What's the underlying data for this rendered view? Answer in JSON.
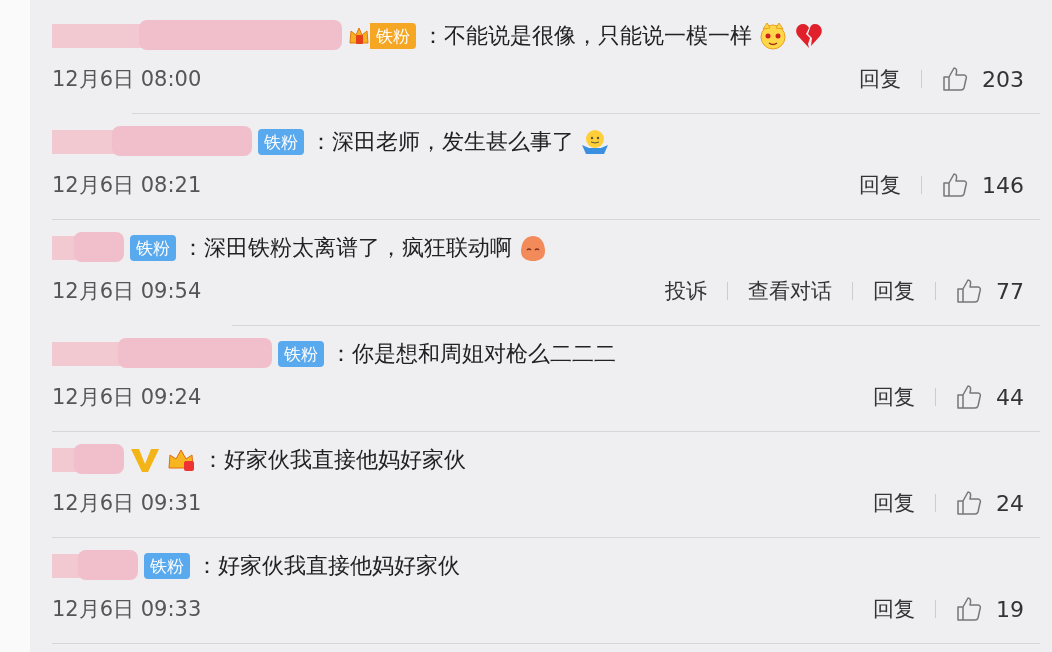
{
  "comments": [
    {
      "badges": [
        {
          "kind": "fan_gold",
          "label": "铁粉"
        }
      ],
      "text": "：不能说是很像，只能说一模一样",
      "emoji": [
        {
          "kind": "face"
        },
        {
          "kind": "broken_heart"
        }
      ],
      "date": "12月6日 08:00",
      "actions": [
        "回复"
      ],
      "likes": "203"
    },
    {
      "badges": [
        {
          "kind": "fan",
          "label": "铁粉"
        }
      ],
      "text": "：深田老师，发生甚么事了",
      "emoji": [
        {
          "kind": "shrug"
        }
      ],
      "date": "12月6日 08:21",
      "actions": [
        "回复"
      ],
      "likes": "146"
    },
    {
      "badges": [
        {
          "kind": "fan",
          "label": "铁粉"
        }
      ],
      "text": "：深田铁粉太离谱了，疯狂联动啊",
      "emoji": [
        {
          "kind": "blob"
        }
      ],
      "date": "12月6日 09:54",
      "actions": [
        "投诉",
        "查看对话",
        "回复"
      ],
      "likes": "77"
    },
    {
      "badges": [
        {
          "kind": "fan",
          "label": "铁粉"
        }
      ],
      "text": "：你是想和周姐对枪么二二二",
      "date": "12月6日 09:24",
      "actions": [
        "回复"
      ],
      "likes": "44"
    },
    {
      "badges": [
        {
          "kind": "vip"
        },
        {
          "kind": "crown"
        }
      ],
      "text": "：好家伙我直接他妈好家伙",
      "date": "12月6日 09:31",
      "actions": [
        "回复"
      ],
      "likes": "24"
    },
    {
      "badges": [
        {
          "kind": "fan",
          "label": "铁粉"
        }
      ],
      "text": "：好家伙我直接他妈好家伙",
      "date": "12月6日 09:33",
      "actions": [
        "回复"
      ],
      "likes": "19"
    }
  ]
}
